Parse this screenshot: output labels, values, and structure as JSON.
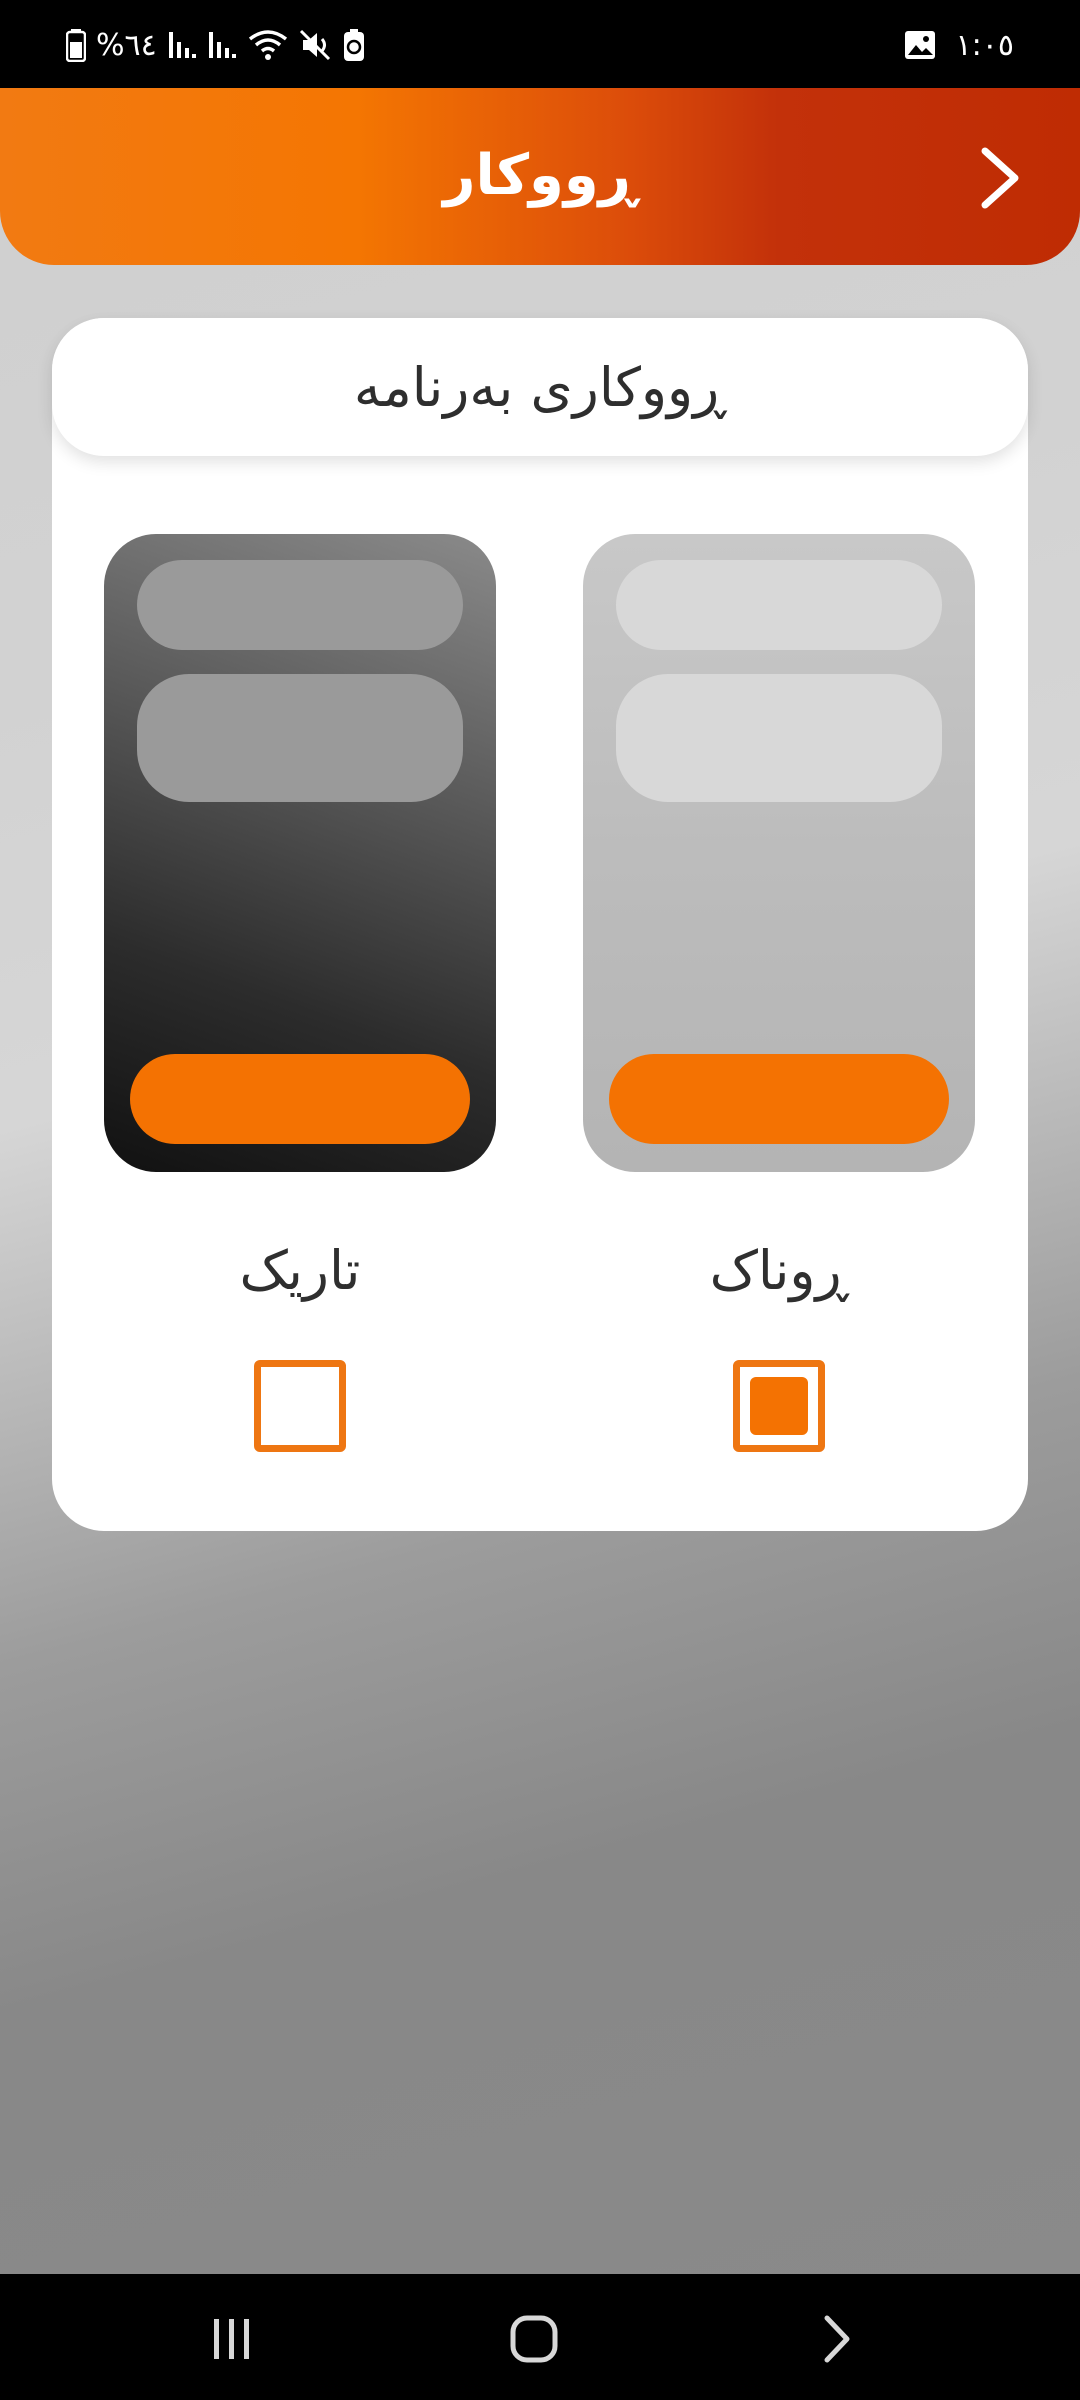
{
  "status_bar": {
    "battery_text": "%٦٤",
    "time": "١:٠٥",
    "icons": [
      "battery-icon",
      "signal-icon",
      "signal-icon",
      "wifi-icon",
      "mute-icon",
      "battery-saver-icon",
      "gallery-icon"
    ]
  },
  "header": {
    "title": "ڕووکار",
    "back_icon": "chevron-right-icon"
  },
  "appearance_card": {
    "title": "ڕووکاری بەرنامە",
    "options": [
      {
        "label": "تاریک",
        "selected": false,
        "preview": "dark"
      },
      {
        "label": "ڕوناک",
        "selected": true,
        "preview": "light"
      }
    ]
  },
  "colors": {
    "accent": "#f47202",
    "header_gradient_start": "#f47602",
    "header_gradient_end": "#bf2c03"
  },
  "nav_bar": {
    "buttons": [
      "recent-apps-icon",
      "home-icon",
      "back-icon"
    ]
  }
}
